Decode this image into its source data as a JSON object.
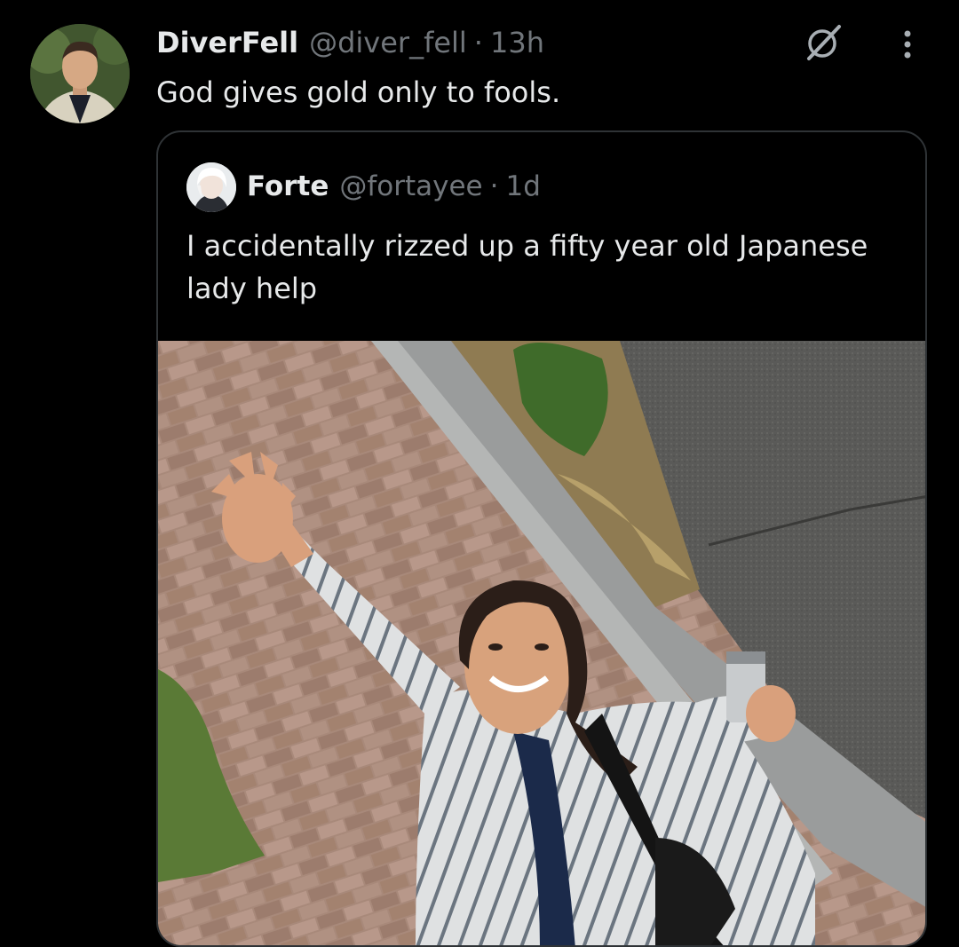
{
  "post": {
    "display_name": "DiverFell",
    "handle": "@diver_fell",
    "separator": "·",
    "timestamp": "13h",
    "text": "God gives gold only to fools."
  },
  "quoted_post": {
    "display_name": "Forte",
    "handle": "@fortayee",
    "separator": "·",
    "timestamp": "1d",
    "text": "I accidentally rizzed up a fifty year old Japanese lady help"
  },
  "icons": {
    "post_avatar": "avatar-man",
    "grok": "grok-icon",
    "more": "more-dots-icon",
    "quote_avatar": "avatar-white-hair"
  },
  "colors": {
    "background": "#000000",
    "primary_text": "#e7e9ea",
    "secondary_text": "#71767b",
    "border": "#2f3336"
  }
}
